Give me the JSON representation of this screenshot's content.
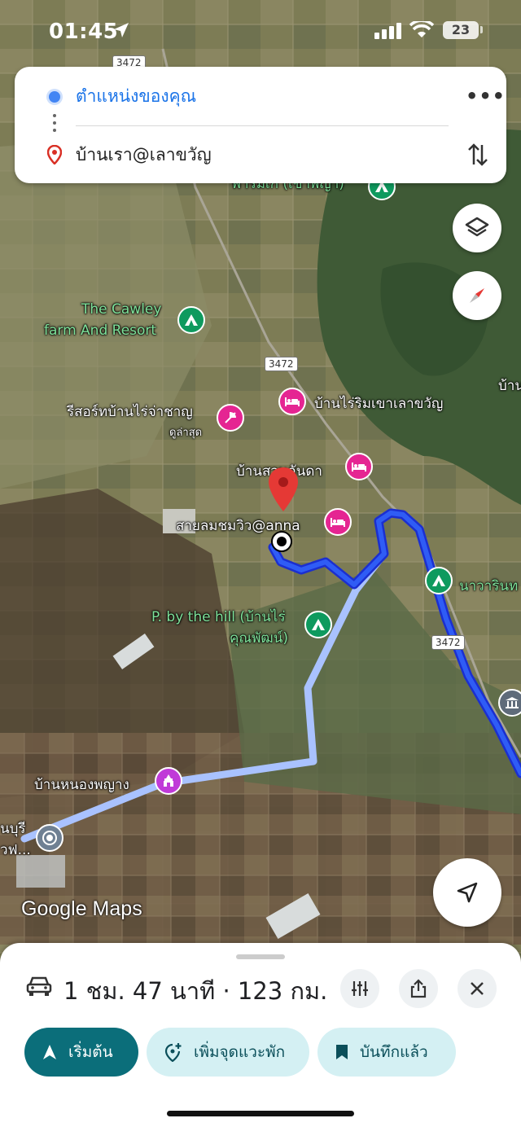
{
  "status_bar": {
    "time": "01:45",
    "battery": "23"
  },
  "directions": {
    "origin": "ตำแหน่งของคุณ",
    "destination": "บ้านเรา@เลาขวัญ",
    "more_label": "•••"
  },
  "map": {
    "road_shield": "3472",
    "labels": {
      "cawley": "The Cawley\nfarm And Resort",
      "cawley_line1": "The Cawley",
      "cawley_line2": "farm And Resort",
      "resort_bannrai": "รีสอร์ทบ้านไร่จ่าชาญ",
      "resort_bannrai_sub": "ดูล่าสุด",
      "banrai_rim_khao": "บ้านไร่ริมเขาเลาขวัญ",
      "ban_suan": "บ้านสวนอันดา",
      "sailom": "สายลมชมวิว@anna",
      "p_by_hill_1": "P. by the hill (บ้านไร่",
      "p_by_hill_2": "คุณพัฒน์)",
      "nawarin": "นาวารินท",
      "ban_nong": "บ้านหนองพญาง",
      "edge_top": "บ้าน",
      "edge_left_1": "นบุรี",
      "edge_left_2": "วฟ...",
      "top_partial": "ฟาร์มเก (เขาพญา)"
    },
    "google_maps_label": "Google Maps",
    "colors": {
      "route_primary": "#1a3fe0",
      "route_alt": "#a9c2ff",
      "pin_red": "#e53935"
    }
  },
  "bottom_sheet": {
    "summary": "1 ชม. 47 นาที · 123 กม.",
    "start_label": "เริ่มต้น",
    "add_stop_label": "เพิ่มจุดแวะพัก",
    "saved_label": "บันทึกแล้ว"
  },
  "icons": [
    "location-arrow-icon",
    "signal-icon",
    "wifi-icon",
    "battery-icon",
    "origin-dot-icon",
    "destination-pin-icon",
    "more-icon",
    "swap-icon",
    "layers-icon",
    "compass-icon",
    "navigate-icon",
    "car-icon",
    "route-options-icon",
    "share-icon",
    "close-icon",
    "navigation-arrow-icon",
    "add-stop-icon",
    "bookmark-icon",
    "camping-icon",
    "hotel-icon",
    "temple-icon",
    "map-pin-icon"
  ]
}
